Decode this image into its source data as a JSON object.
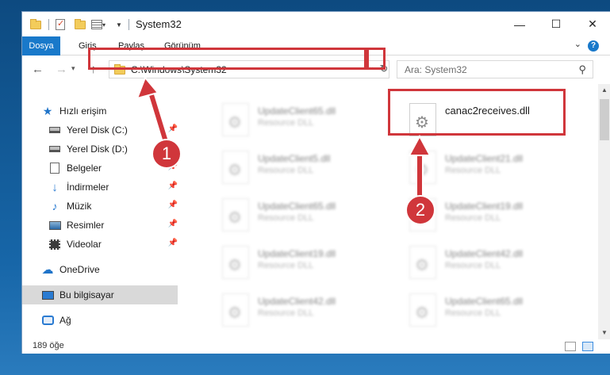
{
  "window": {
    "title": "System32"
  },
  "ribbon": {
    "tabs": [
      "Dosya",
      "Giriş",
      "Paylaş",
      "Görünüm"
    ]
  },
  "controls": {
    "minimize": "—",
    "maximize": "☐",
    "close": "✕",
    "help": "?"
  },
  "address": {
    "path": "C:\\Windows\\System32"
  },
  "search": {
    "placeholder": "Ara: System32"
  },
  "nav": {
    "items": [
      {
        "label": "Hızlı erişim",
        "icon": "star-icon"
      },
      {
        "label": "Yerel Disk (C:)",
        "icon": "drive-icon",
        "pinned": true
      },
      {
        "label": "Yerel Disk (D:)",
        "icon": "drive-icon",
        "pinned": true
      },
      {
        "label": "Belgeler",
        "icon": "documents-icon",
        "pinned": true
      },
      {
        "label": "İndirmeler",
        "icon": "downloads-icon",
        "pinned": true
      },
      {
        "label": "Müzik",
        "icon": "music-icon",
        "pinned": true
      },
      {
        "label": "Resimler",
        "icon": "pictures-icon",
        "pinned": true
      },
      {
        "label": "Videolar",
        "icon": "videos-icon",
        "pinned": true
      },
      {
        "label": "OneDrive",
        "icon": "cloud-icon"
      },
      {
        "label": "Bu bilgisayar",
        "icon": "computer-icon",
        "selected": true
      },
      {
        "label": "Ağ",
        "icon": "network-icon"
      }
    ]
  },
  "files": {
    "highlighted": {
      "name": "canac2receives.dll"
    },
    "items": [
      {
        "name": "UpdateClient65.dll",
        "desc": "Resource DLL"
      },
      {
        "name": "UpdateClient5.dll",
        "desc": "Resource DLL"
      },
      {
        "name": "UpdateClient21.dll",
        "desc": "Resource DLL"
      },
      {
        "name": "UpdateClient65.dll",
        "desc": "Resource DLL"
      },
      {
        "name": "UpdateClient19.dll",
        "desc": "Resource DLL"
      },
      {
        "name": "UpdateClient19.dll",
        "desc": "Resource DLL"
      },
      {
        "name": "UpdateClient42.dll",
        "desc": "Resource DLL"
      },
      {
        "name": "UpdateClient42.dll",
        "desc": "Resource DLL"
      },
      {
        "name": "UpdateClient65.dll",
        "desc": "Resource DLL"
      }
    ]
  },
  "status": {
    "count": "189 öğe"
  },
  "callouts": {
    "one": "1",
    "two": "2"
  },
  "colors": {
    "accent": "#1979ca",
    "highlight": "#d0363b"
  }
}
